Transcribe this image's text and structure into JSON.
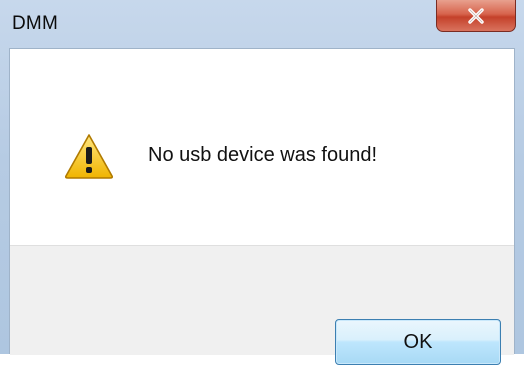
{
  "window": {
    "title": "DMM"
  },
  "titlebar": {
    "close_icon": "close-icon"
  },
  "dialog": {
    "icon": "warning-icon",
    "message": "No usb device was found!",
    "ok_label": "OK"
  },
  "colors": {
    "titlebar": "#b6cbe3",
    "close_button": "#d7644d",
    "button_area": "#f0f0f0",
    "ok_border": "#3c7fb1",
    "warning_yellow": "#f5c400"
  }
}
